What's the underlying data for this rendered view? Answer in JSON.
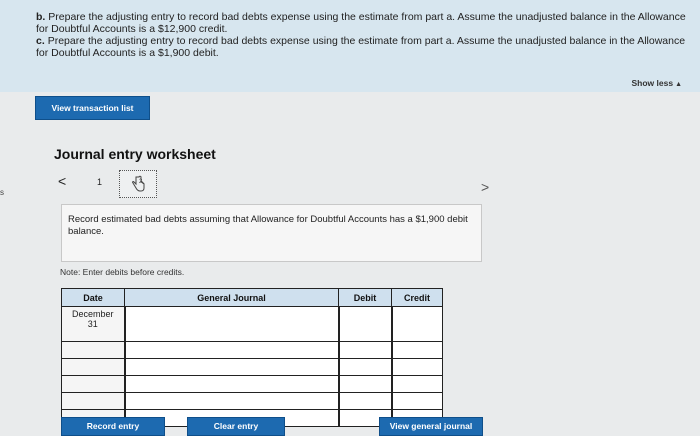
{
  "instructions": {
    "part_b": {
      "label": "b.",
      "text": "Prepare the adjusting entry to record bad debts expense using the estimate from part a. Assume the unadjusted balance in the Allowance for Doubtful Accounts is a $12,900 credit."
    },
    "part_c": {
      "label": "c.",
      "text": "Prepare the adjusting entry to record bad debts expense using the estimate from part a. Assume the unadjusted balance in the Allowance for Doubtful Accounts is a $1,900 debit."
    },
    "show_less": "Show less"
  },
  "buttons": {
    "view_transaction_list": "View transaction list",
    "record_entry": "Record entry",
    "clear_entry": "Clear entry",
    "view_general_journal": "View general journal"
  },
  "worksheet": {
    "title": "Journal entry worksheet",
    "page_number": "1",
    "entry_description": "Record estimated bad debts assuming that Allowance for Doubtful Accounts has a $1,900 debit balance.",
    "note": "Note: Enter debits before credits."
  },
  "journal_table": {
    "headers": [
      "Date",
      "General Journal",
      "Debit",
      "Credit"
    ],
    "rows": [
      {
        "date": "December\n31",
        "account": "",
        "debit": "",
        "credit": ""
      },
      {
        "date": "",
        "account": "",
        "debit": "",
        "credit": ""
      },
      {
        "date": "",
        "account": "",
        "debit": "",
        "credit": ""
      },
      {
        "date": "",
        "account": "",
        "debit": "",
        "credit": ""
      },
      {
        "date": "",
        "account": "",
        "debit": "",
        "credit": ""
      },
      {
        "date": "",
        "account": "",
        "debit": "",
        "credit": ""
      }
    ]
  },
  "icons": {
    "prev": "chevron-left-icon",
    "next": "chevron-right-icon",
    "page_2": "hand-pointer-icon"
  },
  "colors": {
    "accent_button": "#1d6ab0",
    "instruction_bg": "#d7e6ef",
    "table_header_bg": "#cfe0ee"
  }
}
